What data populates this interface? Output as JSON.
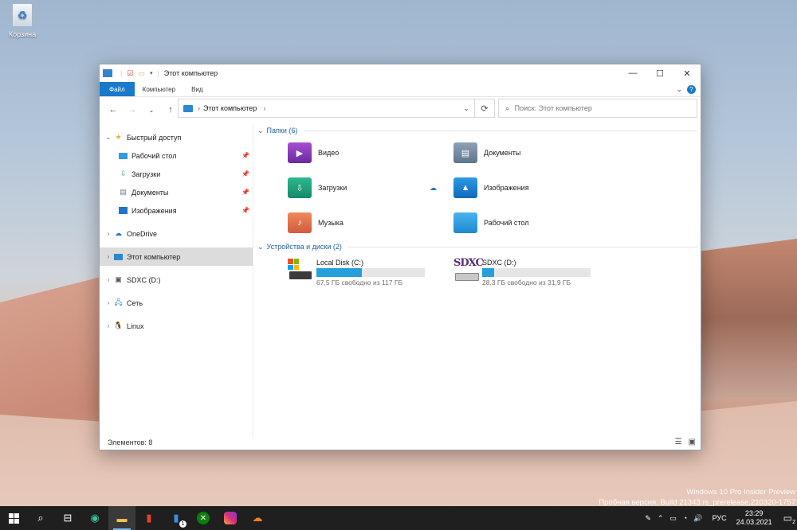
{
  "desktop": {
    "recycle_bin_label": "Корзина",
    "watermark_line1": "Windows 10 Pro Insider Preview",
    "watermark_line2": "Пробная версия. Build 21343.rs_prerelease.210320-1757"
  },
  "window": {
    "title": "Этот компьютер",
    "ribbon_tabs": [
      "Файл",
      "Компьютер",
      "Вид"
    ],
    "address_path": "Этот компьютер",
    "search_placeholder": "Поиск: Этот компьютер",
    "status": "Элементов: 8"
  },
  "sidebar": {
    "quick_access": "Быстрый доступ",
    "quick_items": [
      "Рабочий стол",
      "Загрузки",
      "Документы",
      "Изображения"
    ],
    "onedrive": "OneDrive",
    "this_pc": "Этот компьютер",
    "sdxc": "SDXC (D:)",
    "network": "Сеть",
    "linux": "Linux"
  },
  "content": {
    "folders_header": "Папки (6)",
    "folders": [
      "Видео",
      "Документы",
      "Загрузки",
      "Изображения",
      "Музыка",
      "Рабочий стол"
    ],
    "drives_header": "Устройства и диски (2)",
    "drives": [
      {
        "name": "Local Disk (C:)",
        "free": "67,5 ГБ свободно из 117 ГБ",
        "used_fraction": 0.42
      },
      {
        "name": "SDXC (D:)",
        "free": "28,3 ГБ свободно из 31,9 ГБ",
        "used_fraction": 0.11
      }
    ],
    "sdxc_logo": "SDXC"
  },
  "taskbar": {
    "lang": "РУС",
    "time": "23:29",
    "date": "24.03.2021",
    "notif_count": "2",
    "badge": "1"
  },
  "colors": {
    "accent": "#1979ca",
    "bar": "#26a0da"
  }
}
